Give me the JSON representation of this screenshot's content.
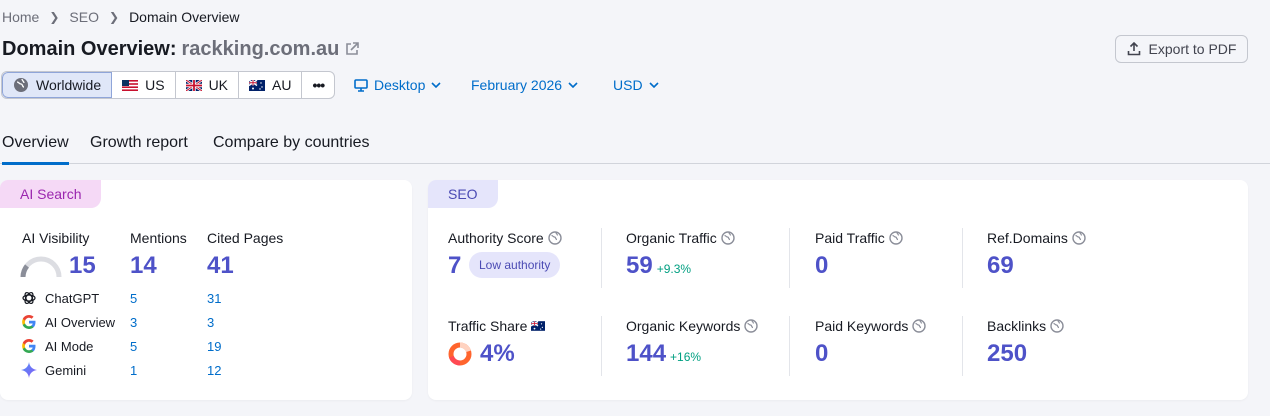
{
  "breadcrumb": [
    "Home",
    "SEO",
    "Domain Overview"
  ],
  "title": {
    "prefix": "Domain Overview:",
    "domain": "rackking.com.au"
  },
  "export_label": "Export to PDF",
  "regions": [
    "Worldwide",
    "US",
    "UK",
    "AU"
  ],
  "more_label": "•••",
  "filters": {
    "device": "Desktop",
    "date": "February 2026",
    "currency": "USD"
  },
  "tabs": [
    "Overview",
    "Growth report",
    "Compare by countries"
  ],
  "ai_card": {
    "tag": "AI Search",
    "visibility_label": "AI Visibility",
    "visibility_value": "15",
    "mentions_label": "Mentions",
    "mentions_value": "14",
    "cited_label": "Cited Pages",
    "cited_value": "41",
    "sources": [
      {
        "name": "ChatGPT",
        "mentions": "5",
        "cited": "31"
      },
      {
        "name": "AI Overview",
        "mentions": "3",
        "cited": "3"
      },
      {
        "name": "AI Mode",
        "mentions": "5",
        "cited": "19"
      },
      {
        "name": "Gemini",
        "mentions": "1",
        "cited": "12"
      }
    ]
  },
  "seo_card": {
    "tag": "SEO",
    "authority_label": "Authority Score",
    "authority_value": "7",
    "authority_pill": "Low authority",
    "organic_traffic_label": "Organic Traffic",
    "organic_traffic_value": "59",
    "organic_traffic_delta": "+9.3%",
    "paid_traffic_label": "Paid Traffic",
    "paid_traffic_value": "0",
    "ref_domains_label": "Ref.Domains",
    "ref_domains_value": "69",
    "traffic_share_label": "Traffic Share",
    "traffic_share_value": "4%",
    "organic_keywords_label": "Organic Keywords",
    "organic_keywords_value": "144",
    "organic_keywords_delta": "+16%",
    "paid_keywords_label": "Paid Keywords",
    "paid_keywords_value": "0",
    "backlinks_label": "Backlinks",
    "backlinks_value": "250"
  },
  "colors": {
    "accent": "#4e52c8",
    "link": "#006dca",
    "positive": "#009f81",
    "ai_tag": "#f5d9f6",
    "seo_tag": "#e5e5fb"
  },
  "icons": [
    "globe-icon",
    "external-link-icon",
    "export-icon",
    "desktop-icon",
    "chevron-down-icon",
    "chatgpt-icon",
    "google-icon",
    "gemini-icon",
    "info-globe-icon"
  ]
}
